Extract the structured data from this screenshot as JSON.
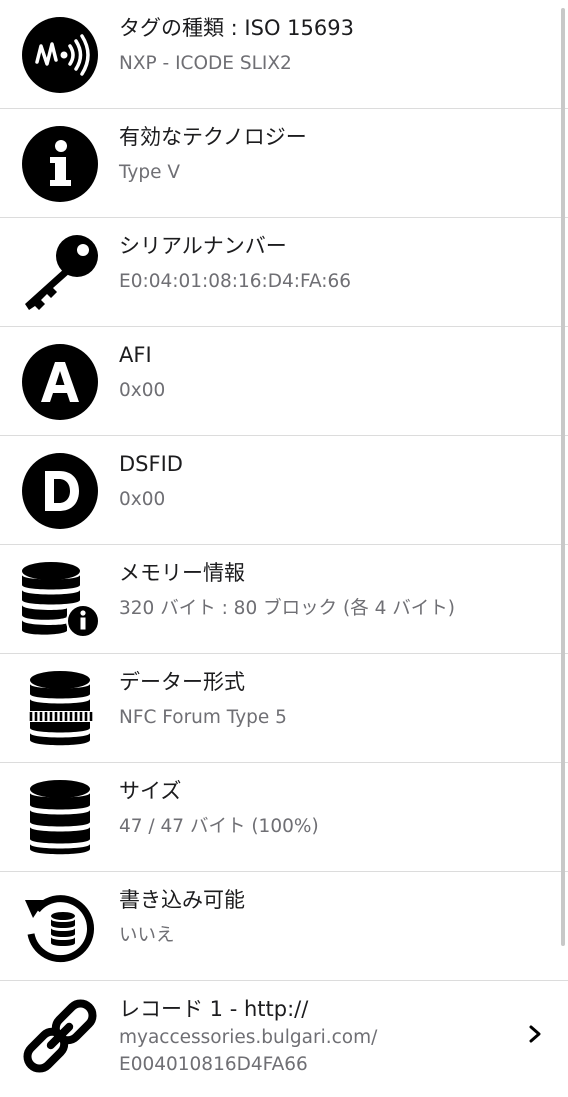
{
  "items": [
    {
      "icon": "nfc-tag-icon",
      "title": "タグの種類 : ISO 15693",
      "subtitle": "NXP - ICODE SLIX2"
    },
    {
      "icon": "info-icon",
      "title": "有効なテクノロジー",
      "subtitle": "Type V"
    },
    {
      "icon": "key-icon",
      "title": "シリアルナンバー",
      "subtitle": "E0:04:01:08:16:D4:FA:66"
    },
    {
      "icon": "letter-a-icon",
      "title": "AFI",
      "subtitle": "0x00"
    },
    {
      "icon": "letter-d-icon",
      "title": "DSFID",
      "subtitle": "0x00"
    },
    {
      "icon": "database-info-icon",
      "title": "メモリー情報",
      "subtitle": "320 バイト : 80 ブロック (各 4 バイト)"
    },
    {
      "icon": "database-format-icon",
      "title": "データー形式",
      "subtitle": "NFC Forum Type 5"
    },
    {
      "icon": "database-icon",
      "title": "サイズ",
      "subtitle": "47 / 47 バイト (100%)"
    },
    {
      "icon": "database-rewrite-icon",
      "title": "書き込み可能",
      "subtitle": "いいえ"
    }
  ],
  "record": {
    "icon": "link-icon",
    "title": "レコード 1 - http://",
    "subtitle_line1": "myaccessories.bulgari.com/",
    "subtitle_line2": "E004010816D4FA66",
    "chevron": "chevron-right-icon"
  }
}
